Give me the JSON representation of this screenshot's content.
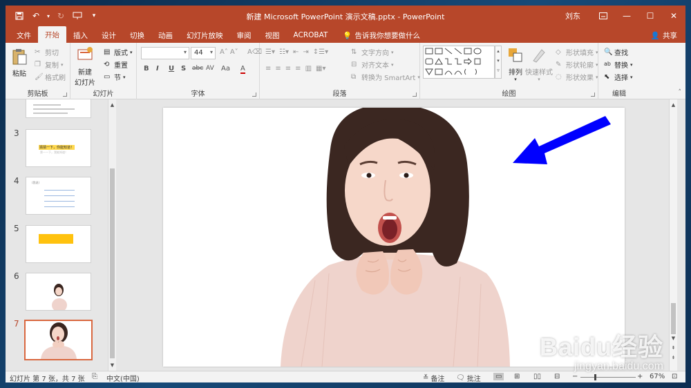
{
  "titlebar": {
    "title": "新建 Microsoft PowerPoint 演示文稿.pptx  -  PowerPoint",
    "user": "刘东",
    "colors": {
      "accent": "#b7472a"
    }
  },
  "tabs": [
    {
      "label": "文件"
    },
    {
      "label": "开始"
    },
    {
      "label": "插入"
    },
    {
      "label": "设计"
    },
    {
      "label": "切换"
    },
    {
      "label": "动画"
    },
    {
      "label": "幻灯片放映"
    },
    {
      "label": "审阅"
    },
    {
      "label": "视图"
    },
    {
      "label": "ACROBAT"
    }
  ],
  "tell_me": "告诉我你想要做什么",
  "share": "共享",
  "ribbon": {
    "clipboard": {
      "label": "剪贴板",
      "paste": "粘贴",
      "cut": "剪切",
      "copy": "复制",
      "format_painter": "格式刷"
    },
    "slides": {
      "label": "幻灯片",
      "new_slide_line1": "新建",
      "new_slide_line2": "幻灯片",
      "layout": "版式",
      "reset": "重置",
      "section": "节"
    },
    "font": {
      "label": "字体",
      "font_name": "",
      "font_size": "44",
      "bold": "B",
      "italic": "I",
      "underline": "U",
      "shadow": "S",
      "strike": "abc",
      "spacing": "AV",
      "case": "Aa",
      "color": "A"
    },
    "paragraph": {
      "label": "段落",
      "text_direction": "文字方向",
      "align_text": "对齐文本",
      "smartart": "转换为 SmartArt"
    },
    "drawing": {
      "label": "绘图",
      "arrange": "排列",
      "quick_styles": "快速样式",
      "shape_fill": "形状填充",
      "shape_outline": "形状轮廓",
      "shape_effects": "形状效果"
    },
    "editing": {
      "label": "编辑",
      "find": "查找",
      "replace": "替换",
      "select": "选择"
    }
  },
  "thumbnails": [
    {
      "number": "3",
      "text_line1": "猜猜一下，你能知道！",
      "text_line2": "第一一下，我能知道！"
    },
    {
      "number": "4",
      "text_line1": "(我说)"
    },
    {
      "number": "5"
    },
    {
      "number": "6"
    },
    {
      "number": "7",
      "active": true
    }
  ],
  "status": {
    "slide_info": "幻灯片 第 7 张，共 7 张",
    "language": "中文(中国)",
    "notes": "备注",
    "comments": "批注",
    "zoom": "67%"
  },
  "watermark": {
    "logo": "Baidu经验",
    "url": "jingyan.baidu.com"
  }
}
